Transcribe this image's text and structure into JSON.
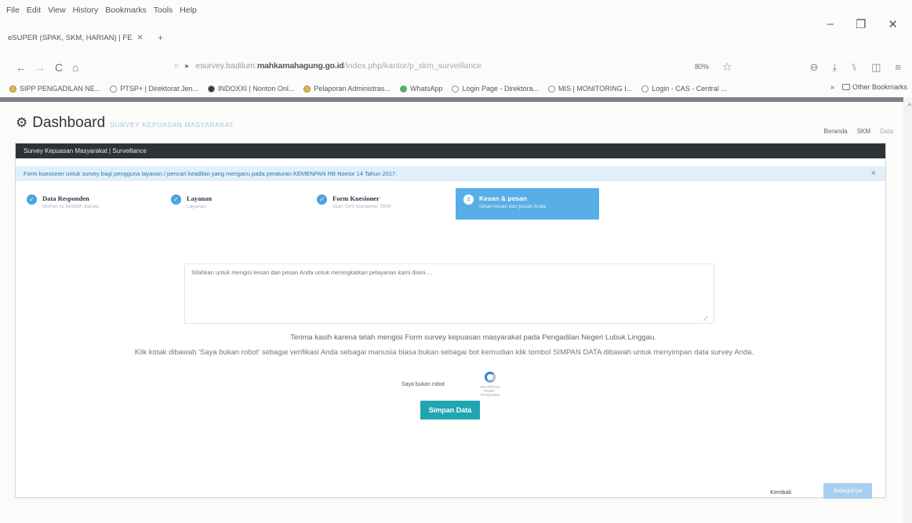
{
  "browser": {
    "menu": [
      "File",
      "Edit",
      "View",
      "History",
      "Bookmarks",
      "Tools",
      "Help"
    ],
    "window_controls": [
      "–",
      "❐",
      "✕"
    ],
    "tab": {
      "title": "eSUPER (SPAK, SKM, HARIAN) | FE",
      "close": "✕",
      "new_tab": "+"
    },
    "nav": {
      "back": "←",
      "forward": "→",
      "reload": "C",
      "home": "⌂",
      "shield": "○",
      "lock": "🔒"
    },
    "url": {
      "prefix": "esurvey.badilum.",
      "domain": "mahkamahagung.go.id",
      "path": "/index.php/kantor/p_skm_surveillance"
    },
    "zoom": "80%",
    "star": "☆",
    "toolbar_right": [
      "⊖",
      "⤓",
      "⑊",
      "◫",
      "≡"
    ],
    "bookmarks": [
      {
        "label": "SIPP PENGADILAN NE...",
        "color": "#f0b52a"
      },
      {
        "label": "PTSP+ | Direktorat Jen...",
        "color": "#ffffff"
      },
      {
        "label": "INDOXXI | Nonton Onl...",
        "color": "#3a3a3a"
      },
      {
        "label": "Pelaporan Administras...",
        "color": "#f0b52a"
      },
      {
        "label": "WhatsApp",
        "color": "#3fbf5a"
      },
      {
        "label": "Login Page - Direktora...",
        "color": "#ffffff"
      },
      {
        "label": "MIS | MONITORING I...",
        "color": "#ffffff"
      },
      {
        "label": "Login - CAS - Central ...",
        "color": "#ffffff"
      }
    ],
    "bookmarks_more": "»",
    "other_bookmarks": "Other Bookmarks",
    "scroll_up": "^"
  },
  "page": {
    "title": "Dashboard",
    "subtitle": "SURVEY KEPUASAN MASYARAKAT",
    "breadcrumb": [
      "Beranda",
      "SKM",
      "Data"
    ],
    "panel_title": "Survey Kepuasan Masyarakat | Surveillance",
    "alert": "Form kuesioner untuk survey bagi pengguna layanan / pencari keadilan yang mengacu pada peraturan KEMENPAN RB Nomor 14 Tahun 2017.",
    "alert_close": "×",
    "steps": [
      {
        "title": "Data Responden",
        "sub": "Mohon isi terlebih dahulu",
        "check": "✓"
      },
      {
        "title": "Layanan",
        "sub": "Layanan",
        "check": "✓"
      },
      {
        "title": "Form Kuesioner",
        "sub": "Isian form kuesioner SKM",
        "check": "✓"
      },
      {
        "title": "Kesan & pesan",
        "sub": "Isikan kesan dan pesan Anda",
        "check": "4"
      }
    ],
    "textarea_placeholder": "Silahkan untuk mengisi kesan dan pesan Anda untuk meningkatkan pelayanan kami disini....",
    "thanks": "Terima kasih karena telah mengisi Form survey kepuasan masyarakat pada Pengadilan Negeri Lubuk Linggau.",
    "instruction": "Klik kotak dibawah 'Saya bukan robot' sebagai verifikasi Anda sebagai manusia biasa bukan sebagai bot kemudian klik tombol SIMPAN DATA dibawah untuk menyimpan data survey Anda.",
    "captcha_label": "Saya bukan robot",
    "captcha_small": "reCAPTCHA Privasi - Persyaratan",
    "save_button": "Simpan Data",
    "back_link": "Kembali",
    "next_button": "Selanjutnya"
  }
}
